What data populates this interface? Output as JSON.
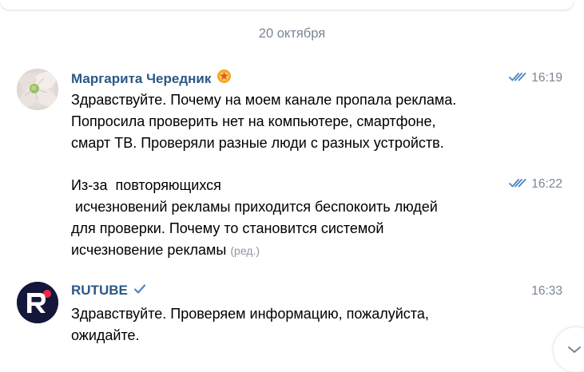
{
  "date_separator": "20 октября",
  "messages": [
    {
      "author": "Маргарита Чередник",
      "time": "16:19",
      "text": "Здравствуйте. Почему на моем канале пропала реклама.\nПопросила проверить нет на компьютере, смартфоне,\nсмарт ТВ. Проверяли разные люди с разных устройств."
    },
    {
      "time": "16:22",
      "text": "Из-за  повторяющихся\n исчезновений рекламы приходится беспокоить людей\nдля проверки. Почему то становится системой\nисчезновение рекламы",
      "edited_label": "(ред.)"
    },
    {
      "author": "RUTUBE",
      "time": "16:33",
      "text": "Здравствуйте. Проверяем информацию, пожалуйста,\nожидайте."
    }
  ],
  "icons": {
    "read_status": "double-check-icon",
    "author_badge": "donut-badge-icon",
    "verified": "verified-check-icon",
    "scroll_down": "chevron-down-icon"
  },
  "colors": {
    "author_name": "#2a5885",
    "meta_gray": "#7a8694",
    "check_blue": "#4a86c5",
    "rutube_dark": "#15173a",
    "rutube_red": "#ee2a46"
  }
}
